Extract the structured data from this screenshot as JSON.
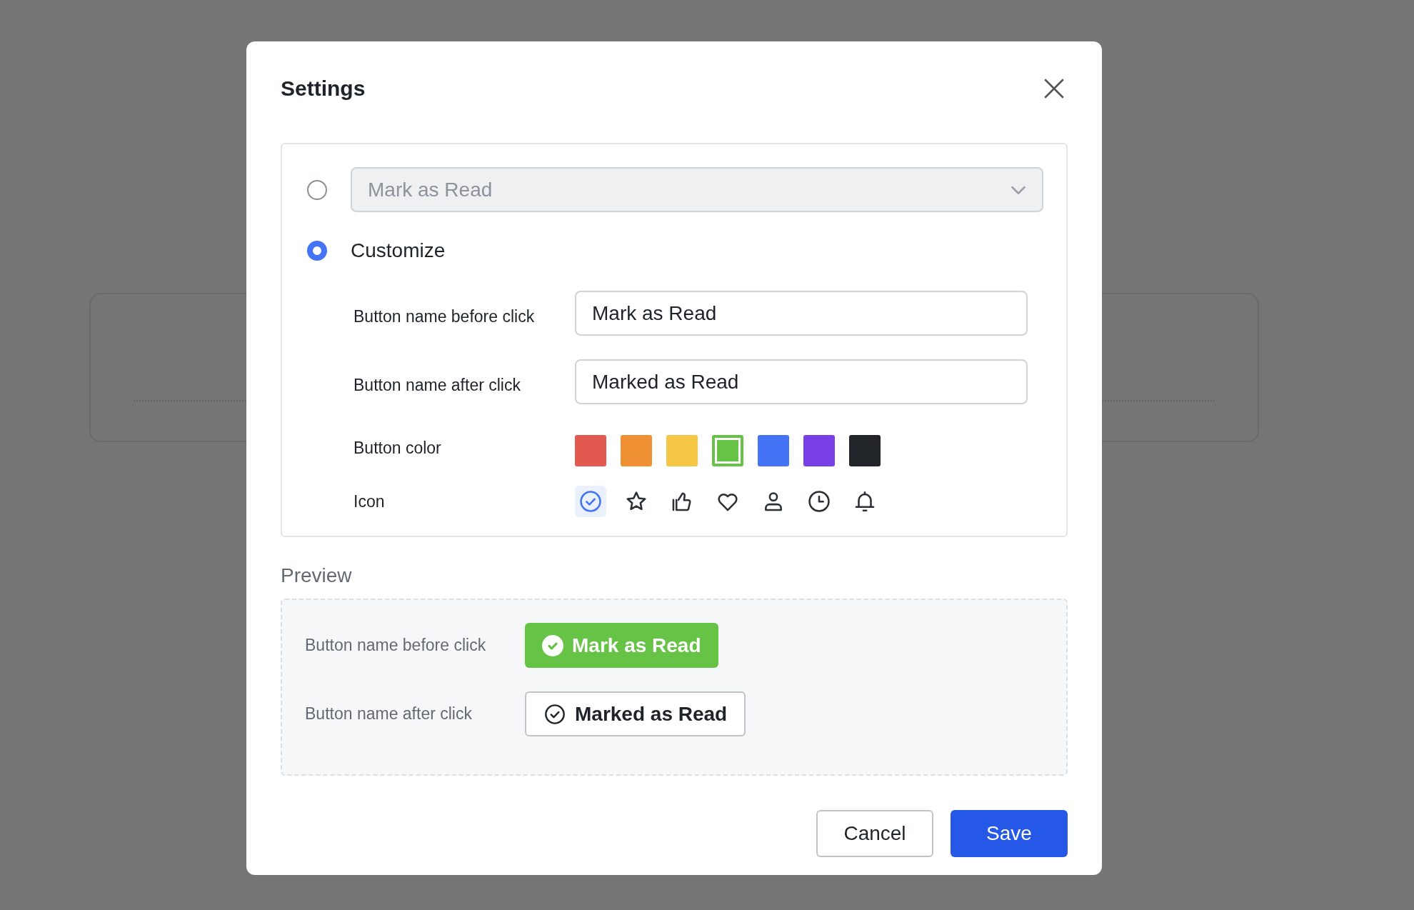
{
  "dialog": {
    "title": "Settings"
  },
  "options": [
    {
      "kind": "dropdown",
      "selected": false,
      "value": "Mark as Read"
    },
    {
      "kind": "custom",
      "selected": true,
      "label": "Customize"
    }
  ],
  "fields": [
    {
      "label": "Button name before click",
      "value": "Mark as Read"
    },
    {
      "label": "Button name after click",
      "value": "Marked as Read"
    }
  ],
  "button_color": {
    "label": "Button color",
    "swatches": [
      {
        "color": "#e25a4f",
        "selected": false
      },
      {
        "color": "#f09035",
        "selected": false
      },
      {
        "color": "#f6c746",
        "selected": false
      },
      {
        "color": "#66c346",
        "selected": true
      },
      {
        "color": "#4474f5",
        "selected": false
      },
      {
        "color": "#7940e8",
        "selected": false
      },
      {
        "color": "#212429",
        "selected": false
      }
    ]
  },
  "icon": {
    "label": "Icon",
    "options": [
      {
        "kind": "check",
        "selected": true
      },
      {
        "kind": "star",
        "selected": false
      },
      {
        "kind": "thumb",
        "selected": false
      },
      {
        "kind": "heart",
        "selected": false
      },
      {
        "kind": "person",
        "selected": false
      },
      {
        "kind": "clock",
        "selected": false
      },
      {
        "kind": "bell",
        "selected": false
      }
    ]
  },
  "preview": {
    "title": "Preview",
    "rows": [
      {
        "kind": "filled",
        "label": "Button name before click",
        "button": "Mark as Read"
      },
      {
        "kind": "outline",
        "label": "Button name after click",
        "button": "Marked as Read"
      }
    ]
  },
  "buttons": [
    {
      "kind": "secondary",
      "label": "Cancel"
    },
    {
      "kind": "primary",
      "label": "Save"
    }
  ]
}
